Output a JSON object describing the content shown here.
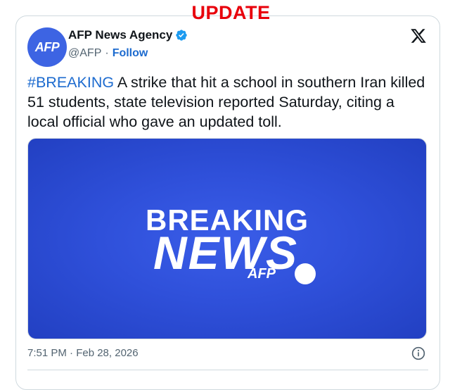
{
  "banner": {
    "label": "UPDATE"
  },
  "author": {
    "avatar_text": "AFP",
    "name": "AFP News Agency",
    "handle": "@AFP",
    "separator": "·",
    "follow_label": "Follow",
    "verified_icon": "verified-badge-icon"
  },
  "platform_icon": "x-logo-icon",
  "tweet": {
    "hashtag": "#BREAKING",
    "text": " A strike that hit a school in southern Iran killed 51 students, state television reported Saturday, citing a local official who gave an updated toll."
  },
  "media": {
    "line1": "BREAKING",
    "line2": "NEWS",
    "agency": "AFP"
  },
  "footer": {
    "timestamp": "7:51 PM · Feb 28, 2026",
    "info_icon": "info-icon"
  },
  "colors": {
    "update_red": "#e8000b",
    "link_blue": "#1d6bcf",
    "avatar_blue": "#3d64e3",
    "media_blue": "#2f50da"
  }
}
